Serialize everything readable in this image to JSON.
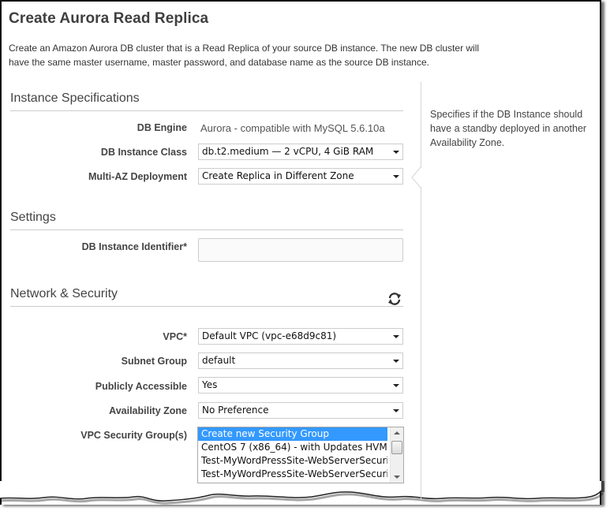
{
  "page": {
    "title": "Create Aurora Read Replica",
    "intro_line1": "Create an Amazon Aurora DB cluster that is a Read Replica of your source DB instance. The new DB cluster will",
    "intro_line2": "have the same master username, master password, and database name as the source DB instance."
  },
  "help": {
    "text": "Specifies if the DB Instance should have a standby deployed in another Availability Zone."
  },
  "instance_specs": {
    "heading": "Instance Specifications",
    "db_engine_label": "DB Engine",
    "db_engine_value": "Aurora - compatible with MySQL 5.6.10a",
    "db_instance_class_label": "DB Instance Class",
    "db_instance_class_value": "db.t2.medium — 2 vCPU, 4 GiB RAM",
    "multi_az_label": "Multi-AZ Deployment",
    "multi_az_value": "Create Replica in Different Zone"
  },
  "settings": {
    "heading": "Settings",
    "db_instance_identifier_label": "DB Instance Identifier*",
    "db_instance_identifier_value": ""
  },
  "network_security": {
    "heading": "Network & Security",
    "refresh_icon": "refresh-icon",
    "vpc_label": "VPC*",
    "vpc_value": "Default VPC (vpc-e68d9c81)",
    "subnet_group_label": "Subnet Group",
    "subnet_group_value": "default",
    "publicly_accessible_label": "Publicly Accessible",
    "publicly_accessible_value": "Yes",
    "availability_zone_label": "Availability Zone",
    "availability_zone_value": "No Preference",
    "security_groups_label": "VPC Security Group(s)",
    "security_groups_options": [
      {
        "label": "Create new Security Group",
        "selected": true
      },
      {
        "label": "CentOS 7 (x86_64) - with Updates HVM",
        "selected": false
      },
      {
        "label": "Test-MyWordPressSite-WebServerSecurityGroup",
        "selected": false
      },
      {
        "label": "Test-MyWordPressSite-WebServerSecurityGroup",
        "selected": false
      }
    ]
  },
  "colors": {
    "selection_highlight": "#3399ff",
    "heading_text": "#3f3f3f",
    "rule": "#cccccc"
  }
}
